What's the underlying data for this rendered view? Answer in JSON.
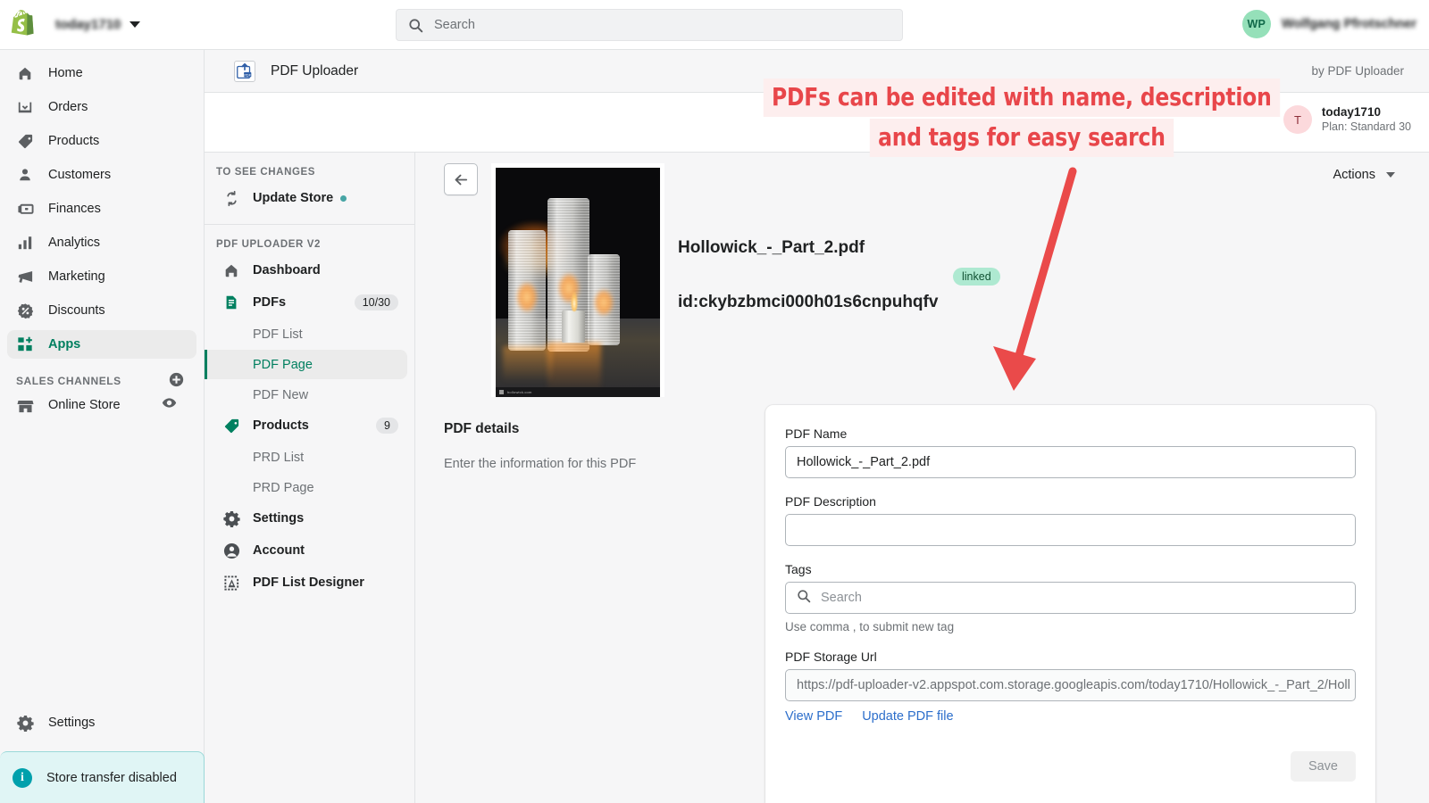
{
  "topbar": {
    "store_name": "today1710",
    "search_placeholder": "Search",
    "user_initials": "WP",
    "user_name": "Wolfgang Pfrotschner"
  },
  "sidebar": {
    "items": [
      {
        "label": "Home",
        "icon": "home-icon"
      },
      {
        "label": "Orders",
        "icon": "orders-icon"
      },
      {
        "label": "Products",
        "icon": "tag-icon"
      },
      {
        "label": "Customers",
        "icon": "person-icon"
      },
      {
        "label": "Finances",
        "icon": "cash-icon"
      },
      {
        "label": "Analytics",
        "icon": "bars-icon"
      },
      {
        "label": "Marketing",
        "icon": "megaphone-icon"
      },
      {
        "label": "Discounts",
        "icon": "discount-icon"
      },
      {
        "label": "Apps",
        "icon": "apps-icon"
      }
    ],
    "sales_channels_label": "SALES CHANNELS",
    "online_store_label": "Online Store",
    "settings_label": "Settings",
    "store_transfer_label": "Store transfer disabled"
  },
  "app_header": {
    "title": "PDF Uploader",
    "by_line": "by PDF Uploader",
    "account_initial": "T",
    "account_name": "today1710",
    "account_plan": "Plan: Standard 30"
  },
  "subnav": {
    "changes_caption": "TO SEE CHANGES",
    "update_store_label": "Update Store",
    "app_caption": "PDF UPLOADER V2",
    "dashboard_label": "Dashboard",
    "pdfs_label": "PDFs",
    "pdfs_badge": "10/30",
    "pdf_list_label": "PDF List",
    "pdf_page_label": "PDF Page",
    "pdf_new_label": "PDF New",
    "products_label": "Products",
    "products_badge": "9",
    "prd_list_label": "PRD List",
    "prd_page_label": "PRD Page",
    "settings_label": "Settings",
    "account_label": "Account",
    "pdf_list_designer_label": "PDF List Designer"
  },
  "main": {
    "actions_label": "Actions",
    "file_title": "Hollowick_-_Part_2.pdf",
    "file_id": "id:ckybzbmci000h01s6cnpuhqfv",
    "linked_badge": "linked",
    "details_heading": "PDF details",
    "details_subtext": "Enter the information for this PDF",
    "thumb_watermark": "hollowick.com"
  },
  "form": {
    "pdf_name_label": "PDF Name",
    "pdf_name_value": "Hollowick_-_Part_2.pdf",
    "pdf_description_label": "PDF Description",
    "pdf_description_value": "",
    "tags_label": "Tags",
    "tags_placeholder": "Search",
    "tags_helper": "Use comma , to submit new tag",
    "storage_url_label": "PDF Storage Url",
    "storage_url_value": "https://pdf-uploader-v2.appspot.com.storage.googleapis.com/today1710/Hollowick_-_Part_2/Holl",
    "view_pdf_label": "View PDF",
    "update_pdf_label": "Update PDF file",
    "save_label": "Save"
  },
  "annotation": {
    "line1": "PDFs can be edited with name, description",
    "line2": "and tags for easy search",
    "color": "#e8464a",
    "bg": "#fdeeee"
  }
}
